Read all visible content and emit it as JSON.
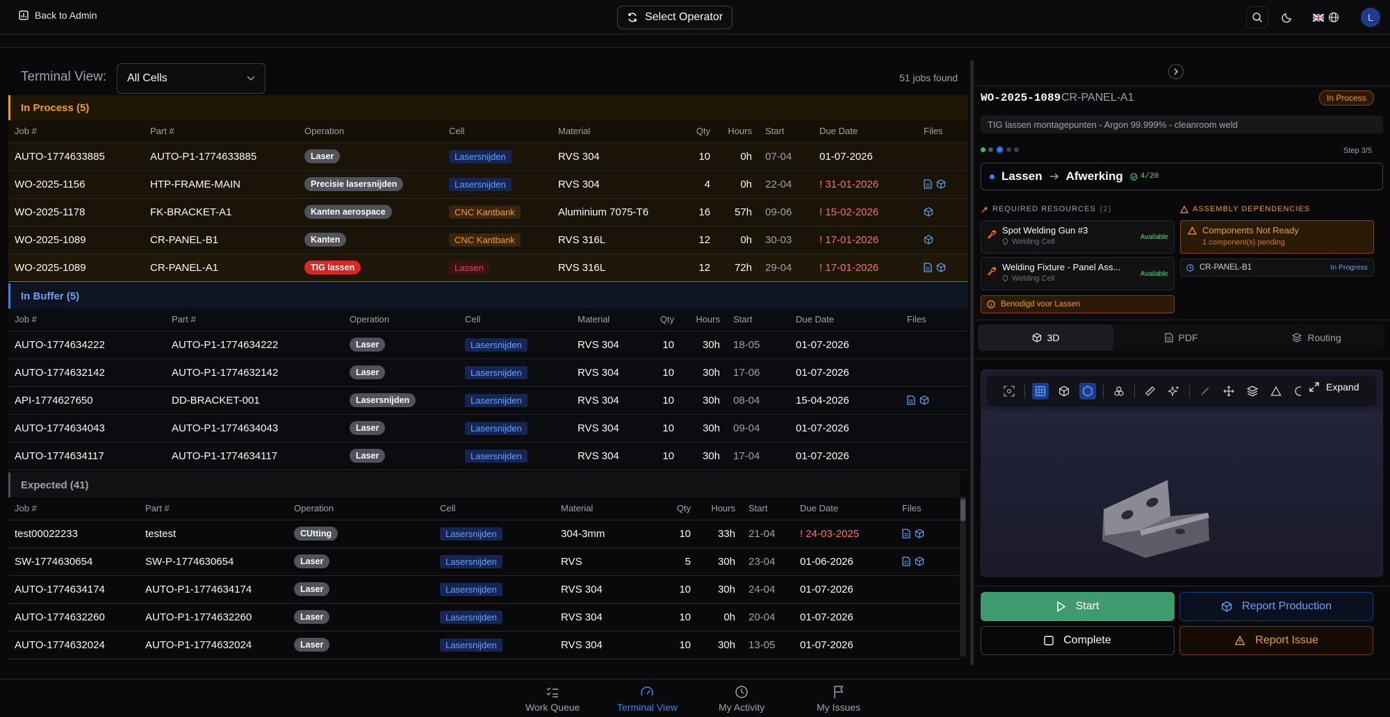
{
  "header": {
    "back_label": "Back to Admin",
    "select_operator_label": "Select Operator",
    "avatar_initial": "L"
  },
  "terminal": {
    "label": "Terminal View:",
    "cell_filter": "All Cells",
    "jobs_found": "51 jobs found"
  },
  "columns": {
    "job": "Job #",
    "part": "Part #",
    "operation": "Operation",
    "cell": "Cell",
    "material": "Material",
    "qty": "Qty",
    "hours": "Hours",
    "start": "Start",
    "due": "Due Date",
    "files": "Files"
  },
  "in_process": {
    "title": "In Process (5)",
    "rows": [
      {
        "job": "AUTO-1774633885",
        "part": "AUTO-P1-1774633885",
        "op": "Laser",
        "cell": "Lasersnijden",
        "material": "RVS 304",
        "qty": "10",
        "hours": "0h",
        "start": "07-04",
        "due": "01-07-2026",
        "overdue": false,
        "files": []
      },
      {
        "job": "WO-2025-1156",
        "part": "HTP-FRAME-MAIN",
        "op": "Precisie lasersnijden",
        "cell": "Lasersnijden",
        "material": "RVS 304",
        "qty": "4",
        "hours": "0h",
        "start": "22-04",
        "due": "! 31-01-2026",
        "overdue": true,
        "files": [
          "doc",
          "cube"
        ]
      },
      {
        "job": "WO-2025-1178",
        "part": "FK-BRACKET-A1",
        "op": "Kanten aerospace",
        "cell": "CNC Kantbank",
        "material": "Aluminium 7075-T6",
        "qty": "16",
        "hours": "57h",
        "start": "09-06",
        "due": "! 15-02-2026",
        "overdue": true,
        "files": [
          "cube"
        ]
      },
      {
        "job": "WO-2025-1089",
        "part": "CR-PANEL-B1",
        "op": "Kanten",
        "cell": "CNC Kantbank",
        "material": "RVS 316L",
        "qty": "12",
        "hours": "0h",
        "start": "30-03",
        "due": "! 17-01-2026",
        "overdue": true,
        "files": [
          "cube"
        ]
      },
      {
        "job": "WO-2025-1089",
        "part": "CR-PANEL-A1",
        "op": "TIG lassen",
        "cell": "Lassen",
        "material": "RVS 316L",
        "qty": "12",
        "hours": "72h",
        "start": "29-04",
        "due": "! 17-01-2026",
        "overdue": true,
        "files": [
          "doc",
          "cube"
        ]
      }
    ]
  },
  "in_buffer": {
    "title": "In Buffer (5)",
    "rows": [
      {
        "job": "AUTO-1774634222",
        "part": "AUTO-P1-1774634222",
        "op": "Laser",
        "cell": "Lasersnijden",
        "material": "RVS 304",
        "qty": "10",
        "hours": "30h",
        "start": "18-05",
        "due": "01-07-2026",
        "files": []
      },
      {
        "job": "AUTO-1774632142",
        "part": "AUTO-P1-1774632142",
        "op": "Laser",
        "cell": "Lasersnijden",
        "material": "RVS 304",
        "qty": "10",
        "hours": "30h",
        "start": "17-06",
        "due": "01-07-2026",
        "files": []
      },
      {
        "job": "API-1774627650",
        "part": "DD-BRACKET-001",
        "op": "Lasersnijden",
        "cell": "Lasersnijden",
        "material": "RVS 304",
        "qty": "10",
        "hours": "30h",
        "start": "08-04",
        "due": "15-04-2026",
        "files": [
          "doc",
          "cube"
        ]
      },
      {
        "job": "AUTO-1774634043",
        "part": "AUTO-P1-1774634043",
        "op": "Laser",
        "cell": "Lasersnijden",
        "material": "RVS 304",
        "qty": "10",
        "hours": "30h",
        "start": "09-04",
        "due": "01-07-2026",
        "files": []
      },
      {
        "job": "AUTO-1774634117",
        "part": "AUTO-P1-1774634117",
        "op": "Laser",
        "cell": "Lasersnijden",
        "material": "RVS 304",
        "qty": "10",
        "hours": "30h",
        "start": "17-04",
        "due": "01-07-2026",
        "files": []
      }
    ]
  },
  "expected": {
    "title": "Expected (41)",
    "rows": [
      {
        "job": "test00022233",
        "part": "testest",
        "op": "CUtting",
        "cell": "Lasersnijden",
        "material": "304-3mm",
        "qty": "10",
        "hours": "33h",
        "start": "21-04",
        "due": "! 24-03-2025",
        "overdue": true,
        "files": [
          "doc",
          "cube"
        ]
      },
      {
        "job": "SW-1774630654",
        "part": "SW-P-1774630654",
        "op": "Laser",
        "cell": "Lasersnijden",
        "material": "RVS",
        "qty": "5",
        "hours": "30h",
        "start": "23-04",
        "due": "01-06-2026",
        "overdue": false,
        "files": [
          "doc",
          "cube"
        ]
      },
      {
        "job": "AUTO-1774634174",
        "part": "AUTO-P1-1774634174",
        "op": "Laser",
        "cell": "Lasersnijden",
        "material": "RVS 304",
        "qty": "10",
        "hours": "30h",
        "start": "24-04",
        "due": "01-07-2026",
        "overdue": false,
        "files": []
      },
      {
        "job": "AUTO-1774632260",
        "part": "AUTO-P1-1774632260",
        "op": "Laser",
        "cell": "Lasersnijden",
        "material": "RVS 304",
        "qty": "10",
        "hours": "0h",
        "start": "20-04",
        "due": "01-07-2026",
        "overdue": false,
        "files": []
      },
      {
        "job": "AUTO-1774632024",
        "part": "AUTO-P1-1774632024",
        "op": "Laser",
        "cell": "Lasersnijden",
        "material": "RVS 304",
        "qty": "10",
        "hours": "30h",
        "start": "13-05",
        "due": "01-07-2026",
        "overdue": false,
        "files": []
      }
    ]
  },
  "detail": {
    "wo": "WO-2025-1089",
    "part": "CR-PANEL-A1",
    "status": "In Process",
    "description": "TIG lassen montagepunten - Argon 99.999% - cleanroom weld",
    "step": "Step 3/5",
    "flow_from": "Lassen",
    "flow_to": "Afwerking",
    "flow_count": "4/20",
    "required_resources_label": "REQUIRED RESOURCES",
    "required_resources_count": "(2)",
    "resources": [
      {
        "name": "Spot Welding Gun #3",
        "location": "Welding Cell",
        "status": "Available"
      },
      {
        "name": "Welding Fixture - Panel Ass...",
        "location": "Welding Cell",
        "status": "Available"
      }
    ],
    "benodigd": "Benodigd voor Lassen",
    "assembly_label": "ASSEMBLY DEPENDENCIES",
    "dep_title": "Components Not Ready",
    "dep_sub": "1 component(s) pending",
    "dep_item": "CR-PANEL-B1",
    "dep_item_status": "In Progress",
    "tabs": [
      "3D",
      "PDF",
      "Routing"
    ],
    "expand_label": "Expand",
    "start_label": "Start",
    "report_production_label": "Report Production",
    "complete_label": "Complete",
    "report_issue_label": "Report Issue"
  },
  "nav": [
    {
      "label": "Work Queue",
      "icon": "list-check-icon"
    },
    {
      "label": "Terminal View",
      "icon": "gauge-icon"
    },
    {
      "label": "My Activity",
      "icon": "clock-icon"
    },
    {
      "label": "My Issues",
      "icon": "flag-icon"
    }
  ],
  "colors": {
    "accent": "#3b82f6",
    "in_process": "#f59e0b",
    "overdue": "#f87171",
    "start_button": "#3f9b6e"
  }
}
